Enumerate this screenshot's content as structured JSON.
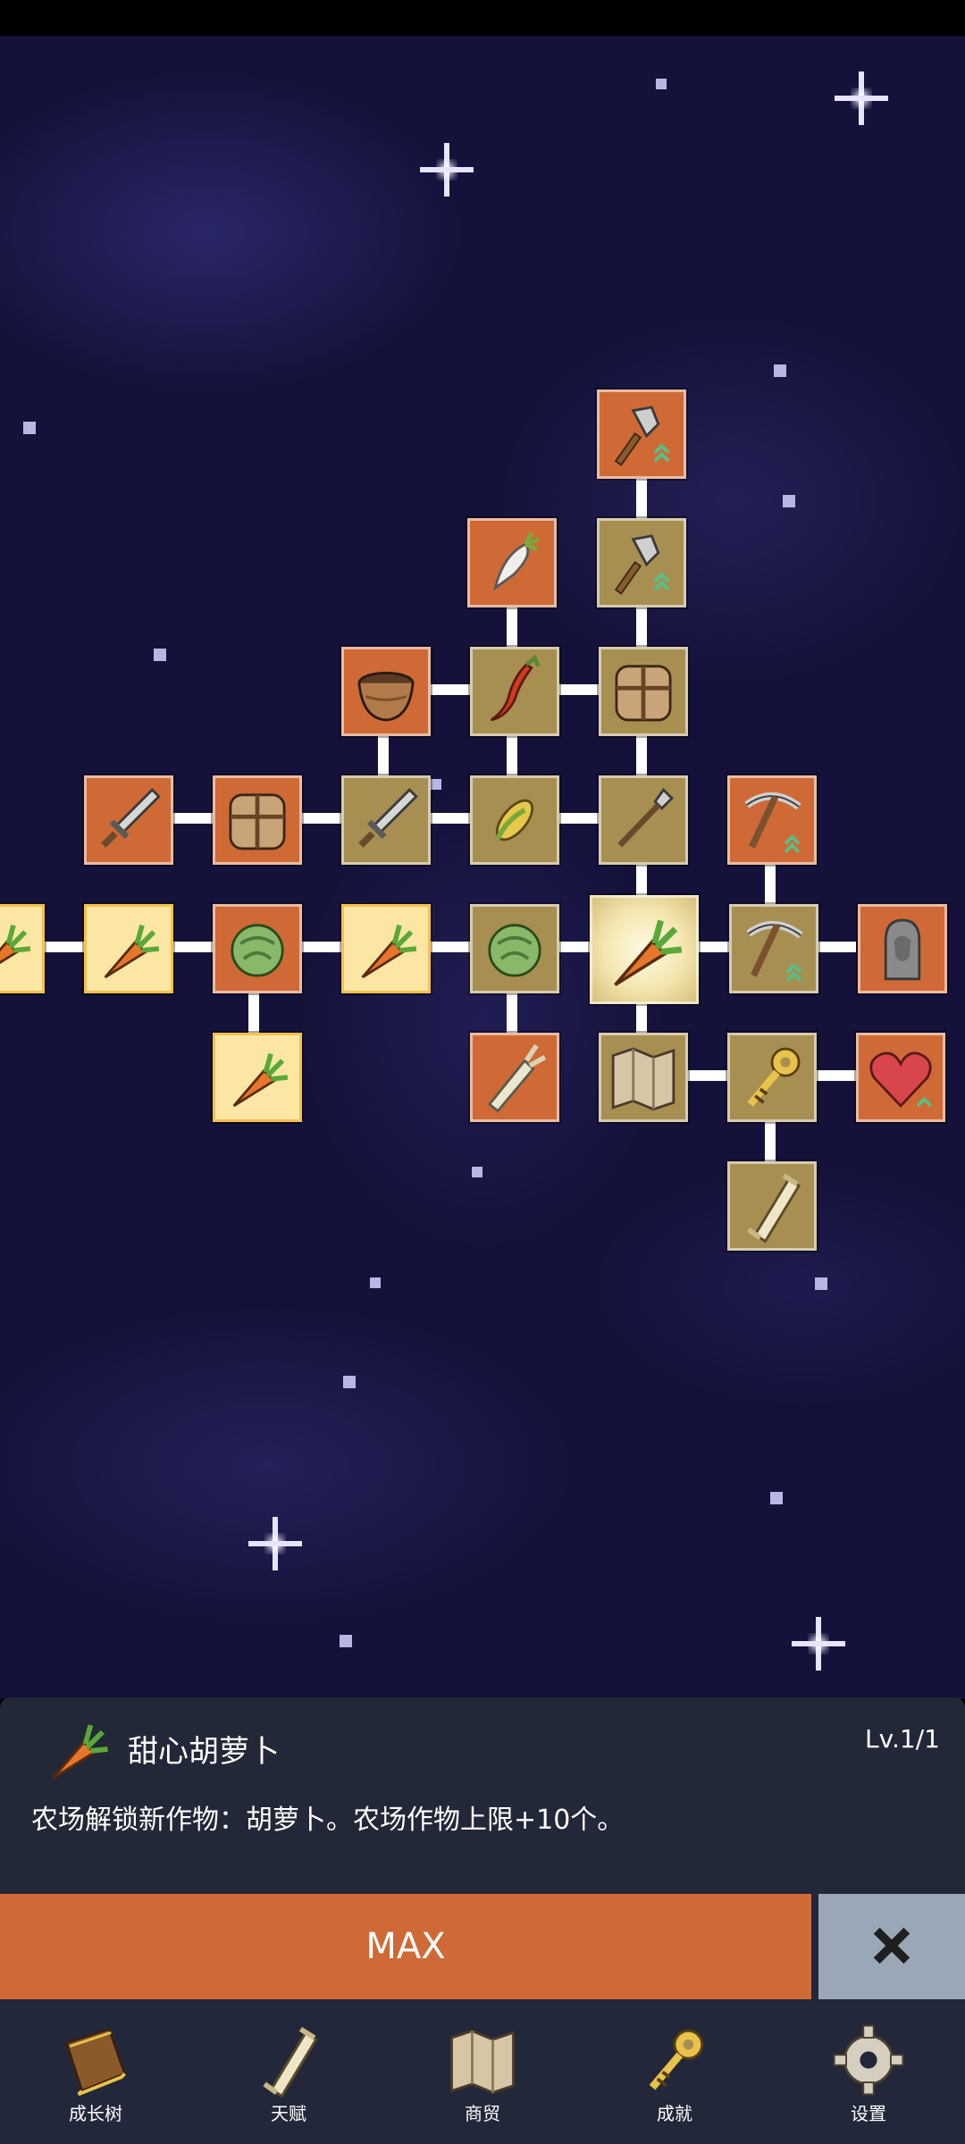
{
  "skill_tree": {
    "nodes": [
      {
        "id": "shovel-top",
        "icon": "shovel-icon",
        "state": "orange"
      },
      {
        "id": "radish",
        "icon": "white-radish-icon",
        "state": "orange"
      },
      {
        "id": "shovel-2",
        "icon": "shovel-icon",
        "state": "unlocked"
      },
      {
        "id": "bowl",
        "icon": "wooden-bowl-icon",
        "state": "orange"
      },
      {
        "id": "chili",
        "icon": "chili-pepper-icon",
        "state": "unlocked"
      },
      {
        "id": "backpack-top",
        "icon": "backpack-icon",
        "state": "unlocked"
      },
      {
        "id": "sword-left",
        "icon": "sword-icon",
        "state": "orange"
      },
      {
        "id": "backpack-left",
        "icon": "backpack-icon",
        "state": "orange"
      },
      {
        "id": "sword-mid",
        "icon": "sword-icon",
        "state": "unlocked"
      },
      {
        "id": "corn",
        "icon": "corn-icon",
        "state": "unlocked"
      },
      {
        "id": "spear",
        "icon": "spear-icon",
        "state": "unlocked"
      },
      {
        "id": "pickaxe-top",
        "icon": "pickaxe-icon",
        "state": "orange"
      },
      {
        "id": "carrot-edge",
        "icon": "carrot-icon",
        "state": "gold"
      },
      {
        "id": "carrot-1",
        "icon": "carrot-icon",
        "state": "gold"
      },
      {
        "id": "cabbage-1",
        "icon": "cabbage-icon",
        "state": "orange"
      },
      {
        "id": "carrot-2",
        "icon": "carrot-icon",
        "state": "gold"
      },
      {
        "id": "cabbage-2",
        "icon": "cabbage-icon",
        "state": "unlocked"
      },
      {
        "id": "carrot-selected",
        "icon": "carrot-icon",
        "state": "selected"
      },
      {
        "id": "pickaxe-2",
        "icon": "pickaxe-icon",
        "state": "unlocked"
      },
      {
        "id": "statue",
        "icon": "statue-icon",
        "state": "orange"
      },
      {
        "id": "carrot-3",
        "icon": "carrot-icon",
        "state": "gold"
      },
      {
        "id": "leek",
        "icon": "leek-icon",
        "state": "orange"
      },
      {
        "id": "map",
        "icon": "map-icon",
        "state": "unlocked"
      },
      {
        "id": "key",
        "icon": "key-icon",
        "state": "unlocked"
      },
      {
        "id": "heart",
        "icon": "heart-icon",
        "state": "orange"
      },
      {
        "id": "scroll",
        "icon": "scroll-icon",
        "state": "unlocked"
      }
    ]
  },
  "detail": {
    "icon": "carrot-icon",
    "title": "甜心胡萝卜",
    "level": "Lv.1/1",
    "description": "农场解锁新作物：胡萝卜。农场作物上限+10个。",
    "max_label": "MAX",
    "close_icon": "close-icon"
  },
  "nav": [
    {
      "label": "成长树",
      "icon": "book-icon"
    },
    {
      "label": "天赋",
      "icon": "scroll-icon"
    },
    {
      "label": "商贸",
      "icon": "map-icon"
    },
    {
      "label": "成就",
      "icon": "key-icon"
    },
    {
      "label": "设置",
      "icon": "gear-icon"
    }
  ],
  "colors": {
    "node_orange": "#cf6a36",
    "node_unlocked": "#a78f52",
    "node_gold": "#fbe6a4",
    "panel": "#232838",
    "close_button": "#9aa7b6"
  }
}
